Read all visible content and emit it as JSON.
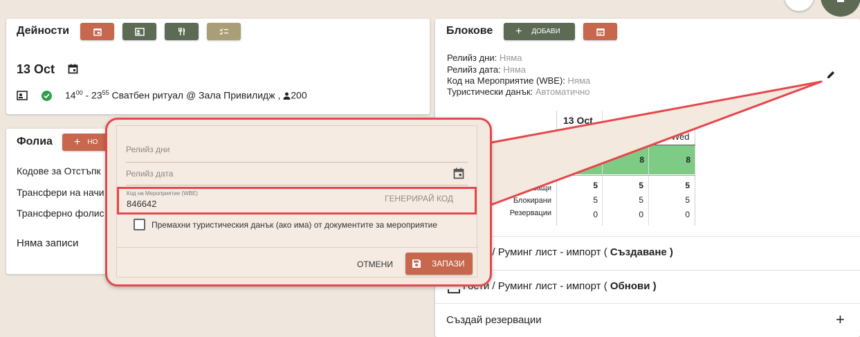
{
  "activities": {
    "title": "Дейности",
    "date": "13 Oct",
    "event": {
      "start_h": "14",
      "start_m": "00",
      "end_h": "23",
      "end_m": "55",
      "text": "Сватбен ритуал @ Зала Привилидж ,",
      "guests": "200"
    }
  },
  "folios": {
    "title": "Фолиа",
    "add_label": "НО",
    "items": [
      "Кодове за Отстъпк",
      "Трансфери на начи",
      "Трансферно фолис"
    ],
    "empty": "Няма записи"
  },
  "blocks": {
    "title": "Блокове",
    "add_label": "ДОБАВИ",
    "release_days_label": "Релийз дни:",
    "release_days_value": "Няма",
    "release_date_label": "Релийз дата:",
    "release_date_value": "Няма",
    "event_code_label": "Код на Мероприятие (WBE):",
    "event_code_value": "Няма",
    "tax_label": "Туристически данък:",
    "tax_value": "Автоматично",
    "grid": {
      "date_header": "13 Oct",
      "day_header": "Wed",
      "totals": [
        "8",
        "8",
        "8"
      ],
      "row_labels": [
        "Оставащи",
        "Блокирани",
        "Резервации"
      ],
      "rows": [
        [
          "5",
          "5",
          "5"
        ],
        [
          "5",
          "5",
          "5"
        ],
        [
          "0",
          "0",
          "0"
        ]
      ]
    },
    "list": [
      {
        "prefix": "Гости / Руминг лист - импорт (",
        "bold": " Създаване ",
        "suffix": ")"
      },
      {
        "prefix": "Гости / Руминг лист - импорт (",
        "bold": " Обнови ",
        "suffix": ")"
      }
    ],
    "create_reservations": "Създай резервации"
  },
  "popup": {
    "release_days_placeholder": "Релийз дни",
    "release_date_placeholder": "Релийз дата",
    "event_code_label": "Код на Мероприятие (WBE)",
    "event_code_value": "846642",
    "generate_label": "ГЕНЕРИРАЙ КОД",
    "checkbox_label": "Премахни туристическия данък (ако има) от документите за мероприятие",
    "cancel_label": "ОТМЕНИ",
    "save_label": "ЗАПАЗИ"
  },
  "colors": {
    "accent_red": "#c7684e",
    "accent_green": "#5d6b55",
    "callout_border": "#e5474b",
    "popup_bg": "#f3e9df",
    "grid_green": "#7ecb85"
  }
}
